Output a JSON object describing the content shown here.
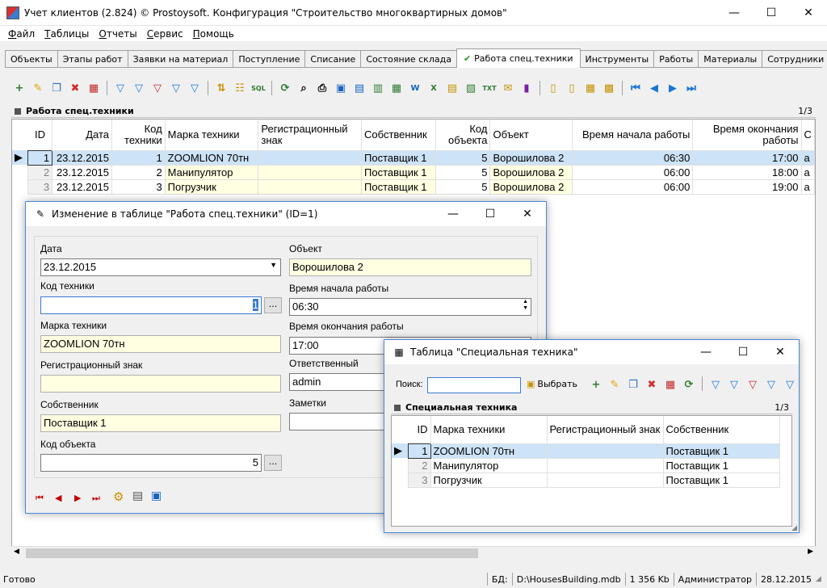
{
  "window": {
    "title": "Учет клиентов (2.824) © Prostoysoft. Конфигурация \"Строительство многоквартирных домов\"",
    "min": "—",
    "max": "☐",
    "close": "✕"
  },
  "menu": [
    "Файл",
    "Таблицы",
    "Отчеты",
    "Сервис",
    "Помощь"
  ],
  "tabs": [
    "Объекты",
    "Этапы работ",
    "Заявки на материал",
    "Поступление",
    "Списание",
    "Состояние склада",
    "Работа спец.техники",
    "Инструменты",
    "Работы",
    "Материалы",
    "Сотрудники"
  ],
  "active_tab_index": 6,
  "section": {
    "title": "Работа спец.техники",
    "count": "1/3"
  },
  "grid": {
    "columns": [
      "ID",
      "Дата",
      "Код техники",
      "Марка техники",
      "Регистрационный знак",
      "Собственник",
      "Код объекта",
      "Объект",
      "Время начала работы",
      "Время окончания работы",
      "С"
    ],
    "rows": [
      {
        "id": "1",
        "date": "23.12.2015",
        "code": "1",
        "brand": "ZOOMLION 70тн",
        "reg": "",
        "owner": "Поставщик 1",
        "obj_code": "5",
        "object": "Ворошилова 2",
        "start": "06:30",
        "end": "17:00",
        "extra": "a"
      },
      {
        "id": "2",
        "date": "23.12.2015",
        "code": "2",
        "brand": "Манипулятор",
        "reg": "",
        "owner": "Поставщик 1",
        "obj_code": "5",
        "object": "Ворошилова 2",
        "start": "06:00",
        "end": "18:00",
        "extra": "a"
      },
      {
        "id": "3",
        "date": "23.12.2015",
        "code": "3",
        "brand": "Погрузчик",
        "reg": "",
        "owner": "Поставщик 1",
        "obj_code": "5",
        "object": "Ворошилова 2",
        "start": "06:00",
        "end": "19:00",
        "extra": "a"
      }
    ]
  },
  "edit_dialog": {
    "title": "Изменение в таблице \"Работа спец.техники\" (ID=1)",
    "labels": {
      "date": "Дата",
      "code": "Код техники",
      "brand": "Марка техники",
      "reg": "Регистрационный знак",
      "owner": "Собственник",
      "obj_code": "Код объекта",
      "object": "Объект",
      "start": "Время начала работы",
      "end": "Время окончания работы",
      "resp": "Ответственный",
      "notes": "Заметки"
    },
    "values": {
      "date": "23.12.2015",
      "code": "1",
      "brand": "ZOOMLION 70тн",
      "reg": "",
      "owner": "Поставщик 1",
      "obj_code": "5",
      "object": "Ворошилова 2",
      "start": "06:30",
      "end": "17:00",
      "resp": "admin",
      "notes": ""
    },
    "dots": "..."
  },
  "lookup_dialog": {
    "title": "Таблица \"Специальная техника\"",
    "search_label": "Поиск:",
    "search_value": "",
    "select_label": "Выбрать",
    "section_title": "Специальная техника",
    "count": "1/3",
    "columns": [
      "ID",
      "Марка техники",
      "Регистрационный знак",
      "Собственник"
    ],
    "rows": [
      {
        "id": "1",
        "brand": "ZOOMLION 70тн",
        "reg": "",
        "owner": "Поставщик 1"
      },
      {
        "id": "2",
        "brand": "Манипулятор",
        "reg": "",
        "owner": "Поставщик 1"
      },
      {
        "id": "3",
        "brand": "Погрузчик",
        "reg": "",
        "owner": "Поставщик 1"
      }
    ]
  },
  "status": {
    "ready": "Готово",
    "db_label": "БД:",
    "db_path": "D:\\HousesBuilding.mdb",
    "size": "1 356 Kb",
    "user": "Администратор",
    "date": "28.12.2015"
  }
}
